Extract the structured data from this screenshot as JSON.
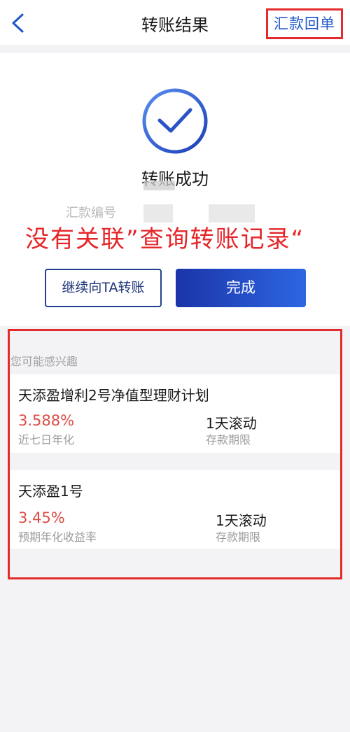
{
  "header": {
    "title": "转账结果",
    "receipt_link": "汇款回单",
    "back_icon": "chevron-left-icon"
  },
  "result": {
    "status_icon": "check-circle-icon",
    "status_text": "转账成功",
    "serial_label": "汇款编号"
  },
  "annotation": "没有关联”查询转账记录“",
  "actions": {
    "continue_label": "继续向TA转账",
    "done_label": "完成"
  },
  "recommendations": {
    "heading": "您可能感兴趣",
    "items": [
      {
        "name": "天添盈增利2号净值型理财计划",
        "rate": "3.588%",
        "rate_label": "近七日年化",
        "term": "1天滚动",
        "term_label": "存款期限"
      },
      {
        "name": "天添盈1号",
        "rate": "3.45%",
        "rate_label": "预期年化收益率",
        "term": "1天滚动",
        "term_label": "存款期限"
      }
    ]
  },
  "colors": {
    "accent_blue": "#1e55c8",
    "annotation_red": "#e5262a",
    "rate_red": "#dc4c45"
  }
}
